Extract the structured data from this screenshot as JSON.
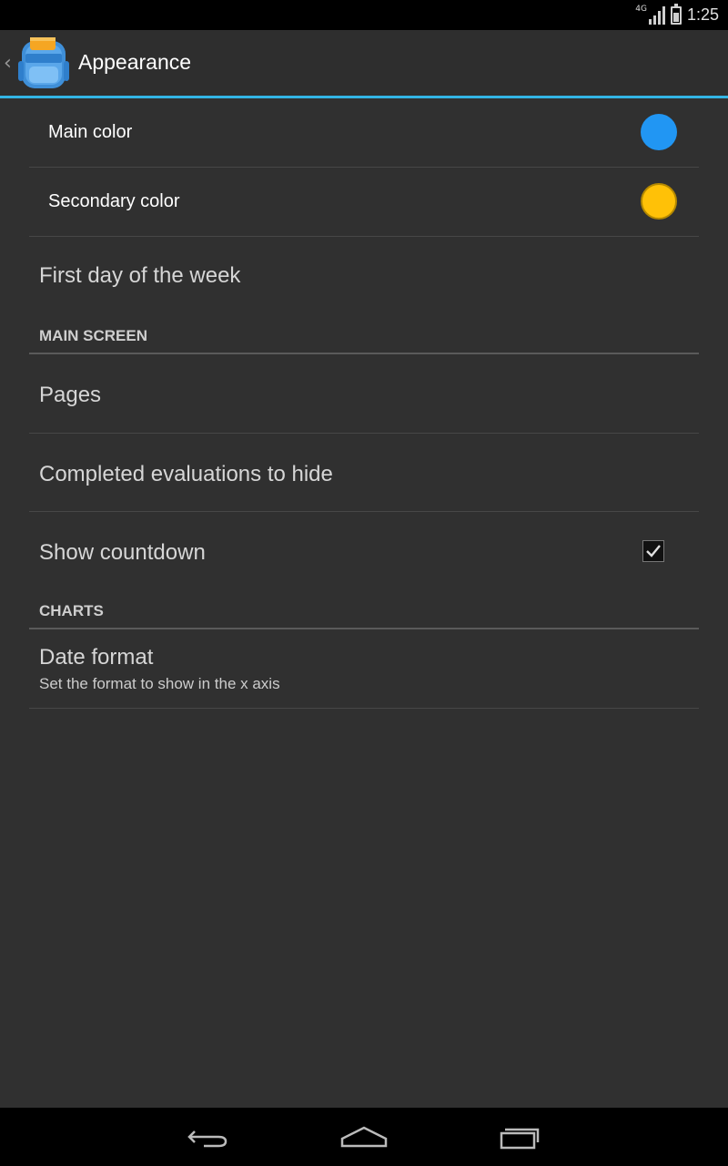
{
  "status_bar": {
    "network": "4G",
    "time": "1:25"
  },
  "action_bar": {
    "title": "Appearance"
  },
  "colors": {
    "main_swatch": "#2196f3",
    "secondary_swatch": "#ffc107",
    "accent": "#33b5e5"
  },
  "preferences": {
    "main_color": "Main color",
    "secondary_color": "Secondary color",
    "first_day": "First day of the week",
    "main_screen_header": "MAIN SCREEN",
    "pages": "Pages",
    "completed_evaluations": "Completed evaluations to hide",
    "show_countdown": "Show countdown",
    "show_countdown_checked": true,
    "charts_header": "CHARTS",
    "date_format": "Date format",
    "date_format_summary": "Set the format to show in the x axis"
  },
  "nav_bar": {
    "back_icon": "back-icon",
    "home_icon": "home-icon",
    "recents_icon": "recents-icon"
  }
}
